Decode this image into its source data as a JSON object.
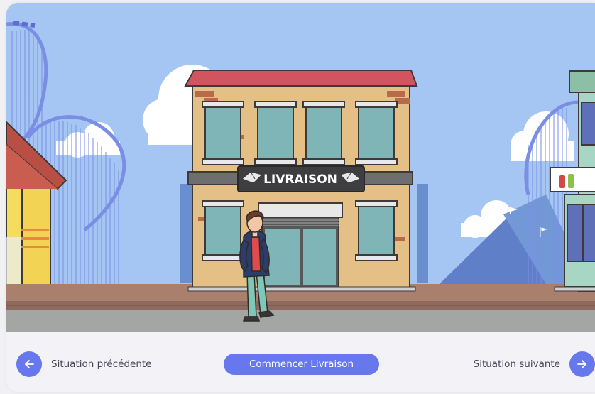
{
  "scene": {
    "shop_sign": "LIVRAISON",
    "colors": {
      "sky": "#a5c6f2",
      "road": "#a3a6a3",
      "sidewalk": "#a97f6e",
      "accent": "#6778ee"
    },
    "icons": [
      "roller-coaster",
      "envelope-icon",
      "soda-bottle-icon",
      "tent"
    ]
  },
  "controls": {
    "prev_label": "Situation précédente",
    "start_label": "Commencer Livraison",
    "next_label": "Situation suivante"
  }
}
